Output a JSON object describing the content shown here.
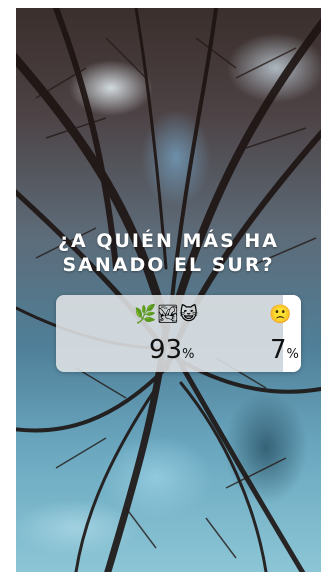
{
  "story": {
    "question_line1": "¿A QUIÉN MÁS HA",
    "question_line2": "SANADO EL SUR?"
  },
  "poll": {
    "options": [
      {
        "emojis": [
          "🌿",
          "🏞",
          "😺"
        ],
        "percent_value": "93",
        "percent_symbol": "%"
      },
      {
        "emojis": [
          "🙁"
        ],
        "percent_value": "7",
        "percent_symbol": "%"
      }
    ]
  }
}
